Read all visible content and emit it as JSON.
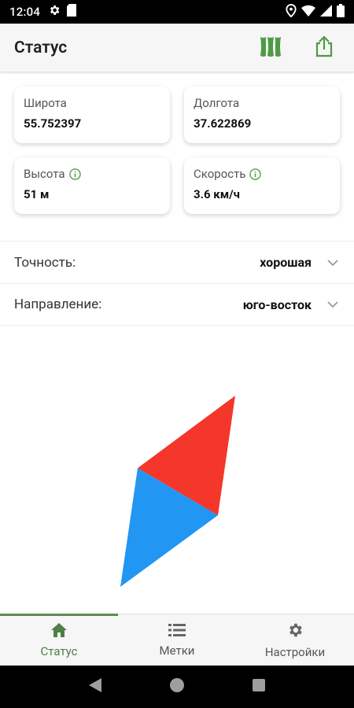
{
  "status_bar": {
    "time": "12:04",
    "icons": [
      "settings-icon",
      "sim-card-icon",
      "location-pin-icon",
      "wifi-icon",
      "signal-icon",
      "battery-icon"
    ]
  },
  "app_bar": {
    "title": "Статус",
    "actions": [
      "map-icon",
      "share-icon"
    ]
  },
  "cards": {
    "latitude": {
      "label": "Широта",
      "value": "55.752397"
    },
    "longitude": {
      "label": "Долгота",
      "value": "37.622869"
    },
    "altitude": {
      "label": "Высота",
      "value": "51 м"
    },
    "speed": {
      "label": "Скорость",
      "value": "3.6 км/ч"
    }
  },
  "rows": {
    "accuracy": {
      "label": "Точность:",
      "value": "хорошая"
    },
    "direction": {
      "label": "Направление:",
      "value": "юго-восток"
    }
  },
  "compass": {
    "north_color": "#f4362b",
    "south_color": "#2196f3"
  },
  "bottom_nav": {
    "items": [
      {
        "label": "Статус",
        "icon": "home-icon",
        "active": true
      },
      {
        "label": "Метки",
        "icon": "list-icon",
        "active": false
      },
      {
        "label": "Настройки",
        "icon": "gear-icon",
        "active": false
      }
    ]
  },
  "colors": {
    "accent": "#4f7f48",
    "appbar_bg": "#f6f6f6"
  }
}
